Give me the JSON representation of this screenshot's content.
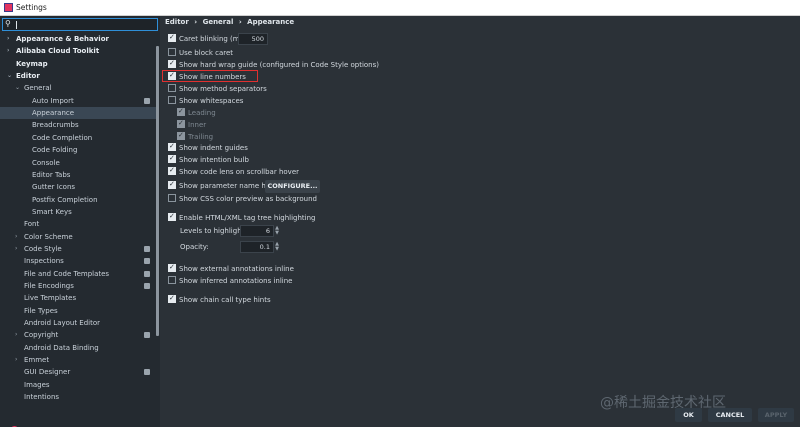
{
  "window": {
    "title": "Settings"
  },
  "sidebar": {
    "items": [
      {
        "label": "Appearance & Behavior",
        "bold": true,
        "arrow": "›"
      },
      {
        "label": "Alibaba Cloud Toolkit",
        "bold": true,
        "arrow": "›"
      },
      {
        "label": "Keymap",
        "bold": true
      },
      {
        "label": "Editor",
        "bold": true,
        "arrow": "⌄"
      },
      {
        "label": "General",
        "arrow": "⌄"
      },
      {
        "label": "Auto Import",
        "badge": true
      },
      {
        "label": "Appearance",
        "selected": true
      },
      {
        "label": "Breadcrumbs"
      },
      {
        "label": "Code Completion"
      },
      {
        "label": "Code Folding"
      },
      {
        "label": "Console"
      },
      {
        "label": "Editor Tabs"
      },
      {
        "label": "Gutter Icons"
      },
      {
        "label": "Postfix Completion"
      },
      {
        "label": "Smart Keys"
      },
      {
        "label": "Font"
      },
      {
        "label": "Color Scheme",
        "arrow": "›"
      },
      {
        "label": "Code Style",
        "arrow": "›",
        "badge": true
      },
      {
        "label": "Inspections",
        "badge": true
      },
      {
        "label": "File and Code Templates",
        "badge": true
      },
      {
        "label": "File Encodings",
        "badge": true
      },
      {
        "label": "Live Templates"
      },
      {
        "label": "File Types"
      },
      {
        "label": "Android Layout Editor"
      },
      {
        "label": "Copyright",
        "arrow": "›",
        "badge": true
      },
      {
        "label": "Android Data Binding"
      },
      {
        "label": "Emmet",
        "arrow": "›"
      },
      {
        "label": "GUI Designer",
        "badge": true
      },
      {
        "label": "Images"
      },
      {
        "label": "Intentions"
      }
    ]
  },
  "breadcrumb": {
    "part1": "Editor",
    "sep1": "›",
    "part2": "General",
    "sep2": "›",
    "part3": "Appearance"
  },
  "options": {
    "caret_blinking": {
      "label": "Caret blinking (ms):",
      "value": "500",
      "checked": true
    },
    "block_caret": {
      "label": "Use block caret",
      "checked": false
    },
    "hard_wrap": {
      "label": "Show hard wrap guide (configured in Code Style options)",
      "checked": true
    },
    "line_numbers": {
      "label": "Show line numbers",
      "checked": true
    },
    "method_separators": {
      "label": "Show method separators",
      "checked": false
    },
    "whitespaces": {
      "label": "Show whitespaces",
      "checked": false
    },
    "leading": {
      "label": "Leading",
      "checked": true
    },
    "inner": {
      "label": "Inner",
      "checked": true
    },
    "trailing": {
      "label": "Trailing",
      "checked": true
    },
    "indent_guides": {
      "label": "Show indent guides",
      "checked": true
    },
    "intention_bulb": {
      "label": "Show intention bulb",
      "checked": true
    },
    "code_lens": {
      "label": "Show code lens on scrollbar hover",
      "checked": true
    },
    "param_hints": {
      "label": "Show parameter name hints",
      "checked": true,
      "button": "CONFIGURE..."
    },
    "css_color": {
      "label": "Show CSS color preview as background",
      "checked": false
    },
    "html_tag_tree": {
      "label": "Enable HTML/XML tag tree highlighting",
      "checked": true
    },
    "levels": {
      "label": "Levels to highlight:",
      "value": "6"
    },
    "opacity": {
      "label": "Opacity:",
      "value": "0.1"
    },
    "external_annotations": {
      "label": "Show external annotations inline",
      "checked": true
    },
    "inferred_annotations": {
      "label": "Show inferred annotations inline",
      "checked": false
    },
    "chain_call": {
      "label": "Show chain call type hints",
      "checked": true
    }
  },
  "footer": {
    "ok": "OK",
    "cancel": "CANCEL",
    "apply": "APPLY",
    "watermark": "@稀土掘金技术社区"
  }
}
